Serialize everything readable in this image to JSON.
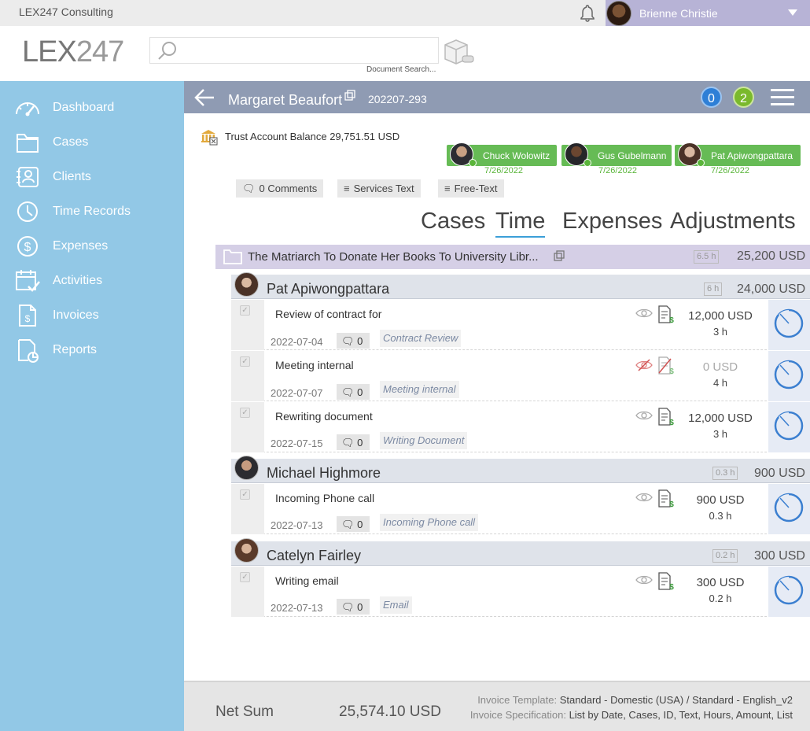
{
  "topbar": {
    "app_name": "LEX247 Consulting",
    "user_name": "Brienne Christie"
  },
  "header": {
    "logo_main": "LEX",
    "logo_num": "247",
    "search_placeholder": "",
    "search_caption": "Document Search..."
  },
  "sidebar": {
    "items": [
      {
        "label": "Dashboard",
        "icon": "speedometer-icon"
      },
      {
        "label": "Cases",
        "icon": "folder-icon"
      },
      {
        "label": "Clients",
        "icon": "contacts-icon"
      },
      {
        "label": "Time Records",
        "icon": "clock-icon"
      },
      {
        "label": "Expenses",
        "icon": "dollar-circle-icon"
      },
      {
        "label": "Activities",
        "icon": "calendar-check-icon"
      },
      {
        "label": "Invoices",
        "icon": "invoice-icon"
      },
      {
        "label": "Reports",
        "icon": "report-icon"
      }
    ]
  },
  "client_bar": {
    "name": "Margaret Beaufort",
    "id": "202207-293",
    "badge_blue": "0",
    "badge_green": "2"
  },
  "trust": {
    "text": "Trust Account Balance 29,751.51 USD"
  },
  "assignees": [
    {
      "name": "Chuck Wolowitz",
      "date": "7/26/2022"
    },
    {
      "name": "Gus Gubelmann",
      "date": "7/26/2022"
    },
    {
      "name": "Pat Apiwongpattara",
      "date": "7/26/2022"
    }
  ],
  "tools": {
    "comments": "0 Comments",
    "services_text": "Services Text",
    "free_text": "Free-Text"
  },
  "tabs": [
    "Cases",
    "Time",
    "Expenses",
    "Adjustments"
  ],
  "case": {
    "title": "The Matriarch To Donate Her Books To University Libr...",
    "hours": "6.5 h",
    "amount": "25,200 USD"
  },
  "people": [
    {
      "name": "Pat Apiwongpattara",
      "hours": "6 h",
      "amount": "24,000 USD",
      "entries": [
        {
          "title": "Review of contract for",
          "date": "2022-07-04",
          "comments": "0",
          "service": "Contract Review",
          "amount": "12,000 USD",
          "hours": "3 h",
          "billable": true
        },
        {
          "title": "Meeting internal",
          "date": "2022-07-07",
          "comments": "0",
          "service": "Meeting internal",
          "amount": "0 USD",
          "hours": "4 h",
          "billable": false
        },
        {
          "title": "Rewriting document",
          "date": "2022-07-15",
          "comments": "0",
          "service": "Writing Document",
          "amount": "12,000 USD",
          "hours": "3 h",
          "billable": true
        }
      ]
    },
    {
      "name": "Michael Highmore",
      "hours": "0.3 h",
      "amount": "900 USD",
      "entries": [
        {
          "title": "Incoming Phone call",
          "date": "2022-07-13",
          "comments": "0",
          "service": "Incoming Phone call",
          "amount": "900 USD",
          "hours": "0.3 h",
          "billable": true
        }
      ]
    },
    {
      "name": "Catelyn Fairley",
      "hours": "0.2 h",
      "amount": "300 USD",
      "entries": [
        {
          "title": "Writing email",
          "date": "2022-07-13",
          "comments": "0",
          "service": "Email",
          "amount": "300 USD",
          "hours": "0.2 h",
          "billable": true
        }
      ]
    }
  ],
  "footer": {
    "net_label": "Net Sum",
    "net_value": "25,574.10 USD",
    "template_label": "Invoice Template:",
    "template_value": "Standard - Domestic (USA) / Standard - English_v2",
    "spec_label": "Invoice Specification:",
    "spec_value": "List by Date, Cases, ID, Text, Hours, Amount, List"
  },
  "colors": {
    "sidebar": "#92c8e6",
    "client_bar": "#8f9bb3",
    "case_row": "#d5cfe6",
    "assignee": "#66bb55",
    "badge_blue": "#2e7fd6",
    "badge_green": "#7ab92c"
  }
}
